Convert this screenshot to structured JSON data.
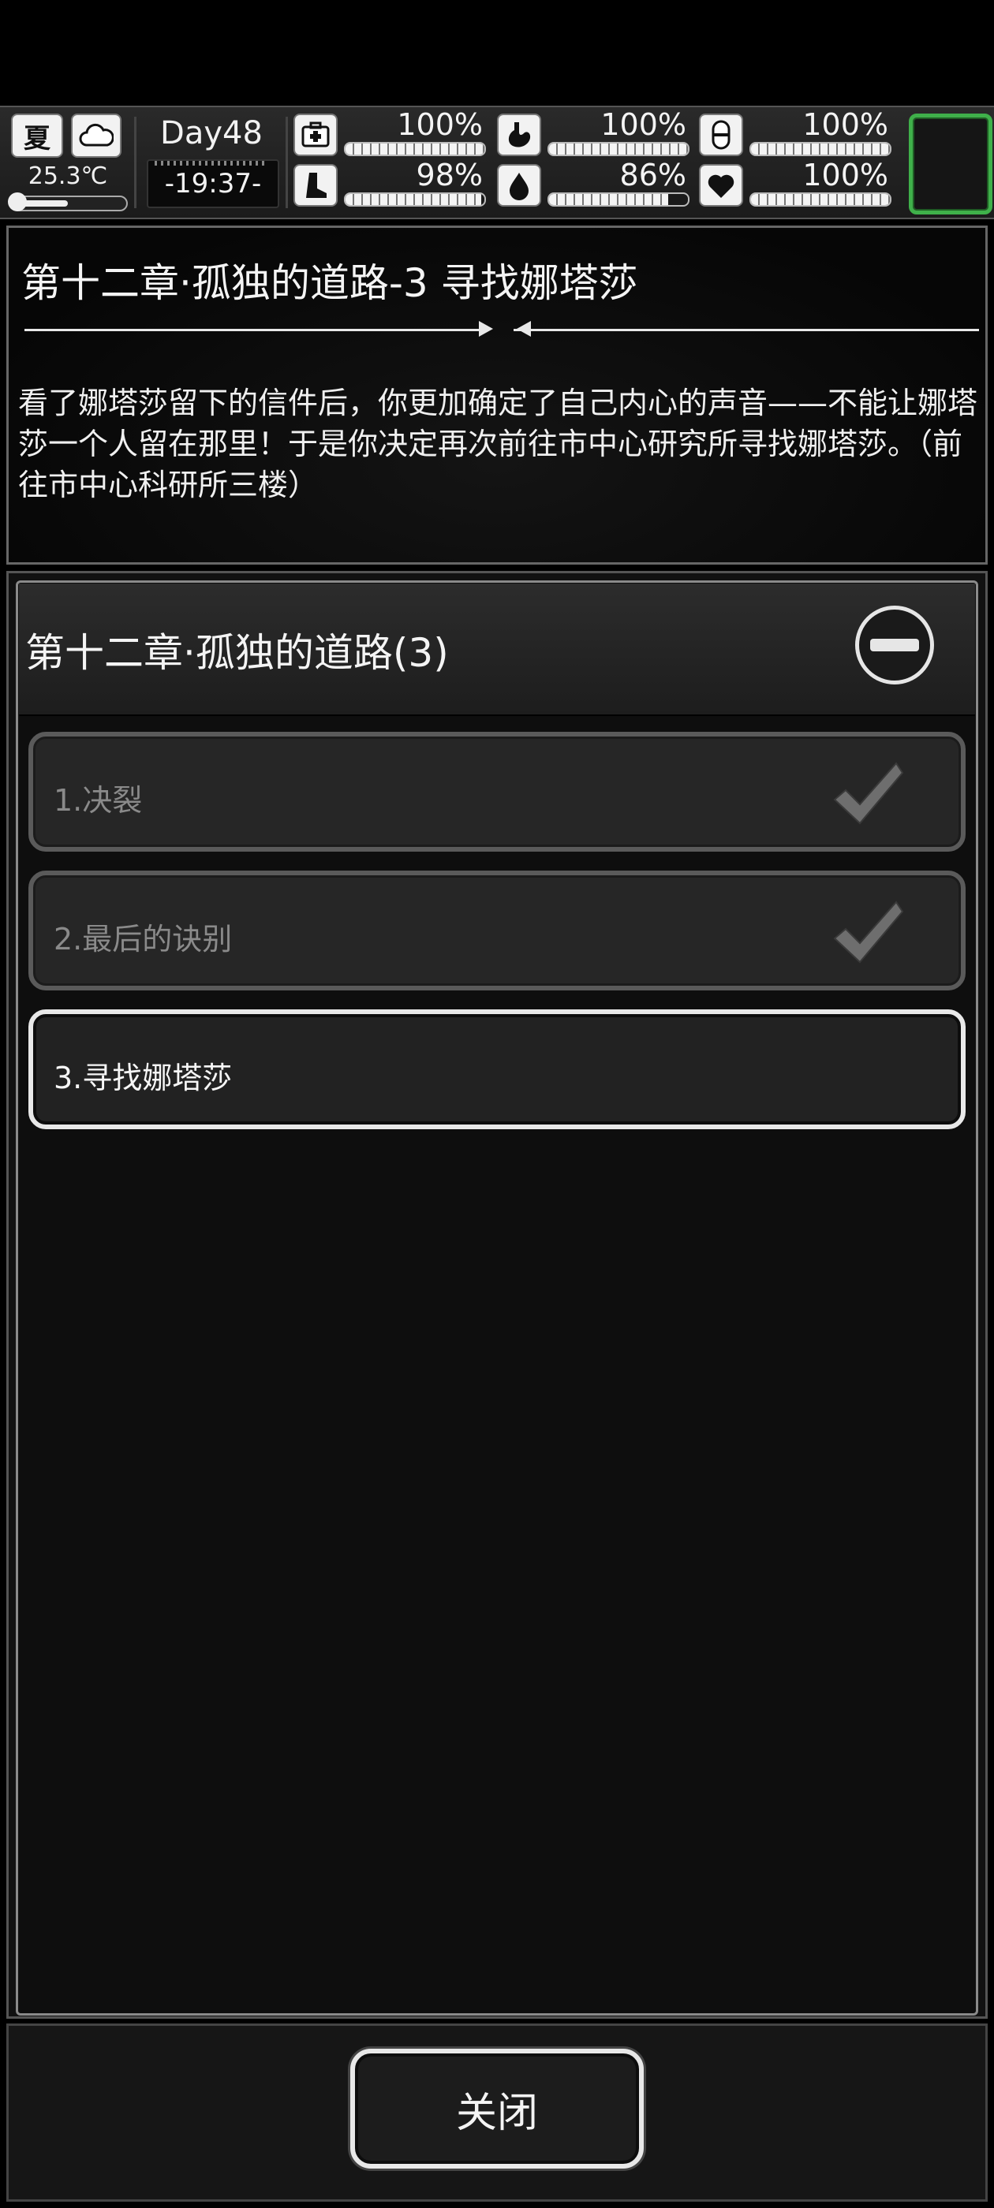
{
  "hud": {
    "season": "夏",
    "temperature": "25.3℃",
    "day": "Day48",
    "clock": "-19:37-",
    "stats": [
      {
        "icon": "medkit-icon",
        "label": "100%",
        "level": 1.0
      },
      {
        "icon": "stomach-icon",
        "label": "100%",
        "level": 1.0
      },
      {
        "icon": "pill-icon",
        "label": "100%",
        "level": 1.0
      },
      {
        "icon": "foot-icon",
        "label": "98%",
        "level": 0.98
      },
      {
        "icon": "water-drop-icon",
        "label": "86%",
        "level": 0.86
      },
      {
        "icon": "heart-icon",
        "label": "100%",
        "level": 1.0
      }
    ],
    "accent_color": "#3fb04a"
  },
  "quest": {
    "title": "第十二章·孤独的道路-3 寻找娜塔莎",
    "description": "看了娜塔莎留下的信件后，你更加确定了自己内心的声音——不能让娜塔莎一个人留在那里！于是你决定再次前往市中心研究所寻找娜塔莎。（前往市中心科研所三楼）"
  },
  "chapter": {
    "title": "第十二章·孤独的道路(3)",
    "items": [
      {
        "label": "1.决裂",
        "status": "completed"
      },
      {
        "label": "2.最后的诀别",
        "status": "completed"
      },
      {
        "label": "3.寻找娜塔莎",
        "status": "active"
      }
    ]
  },
  "footer": {
    "close_label": "关闭"
  }
}
